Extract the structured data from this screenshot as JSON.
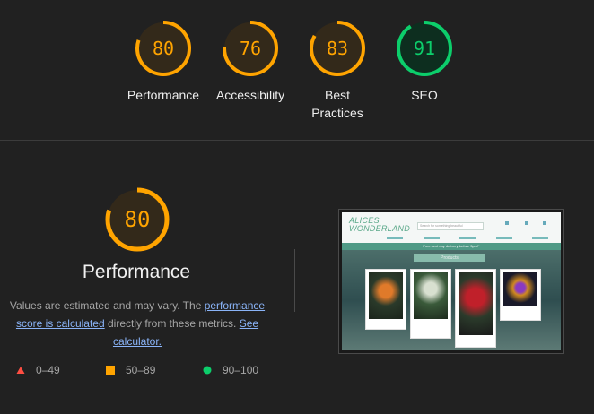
{
  "summary_scores": [
    {
      "label": "Performance",
      "score": 80,
      "status": "average"
    },
    {
      "label": "Accessibility",
      "score": 76,
      "status": "average"
    },
    {
      "label": "Best Practices",
      "score": 83,
      "status": "average"
    },
    {
      "label": "SEO",
      "score": 91,
      "status": "pass"
    }
  ],
  "detail": {
    "score": 80,
    "title": "Performance",
    "desc_prefix": "Values are estimated and may vary. The ",
    "desc_link1": "performance score is calculated",
    "desc_middle": " directly from these metrics. ",
    "desc_link2": "See calculator."
  },
  "legend": [
    {
      "range": "0–49",
      "shape": "triangle",
      "color": "#ff4e42"
    },
    {
      "range": "50–89",
      "shape": "square",
      "color": "#ffa400"
    },
    {
      "range": "90–100",
      "shape": "circle",
      "color": "#0cce6b"
    }
  ],
  "thumbnail": {
    "logo_line1": "ALICES",
    "logo_line2": "WONDERLAND",
    "search_placeholder": "Search for something beautiful",
    "banner": "Free next day delivery before 3pm!*",
    "heading": "Products"
  },
  "colors": {
    "average": "#ffa400",
    "average_bg": "#33291a",
    "pass": "#0cce6b",
    "pass_bg": "#0d2e1f"
  }
}
